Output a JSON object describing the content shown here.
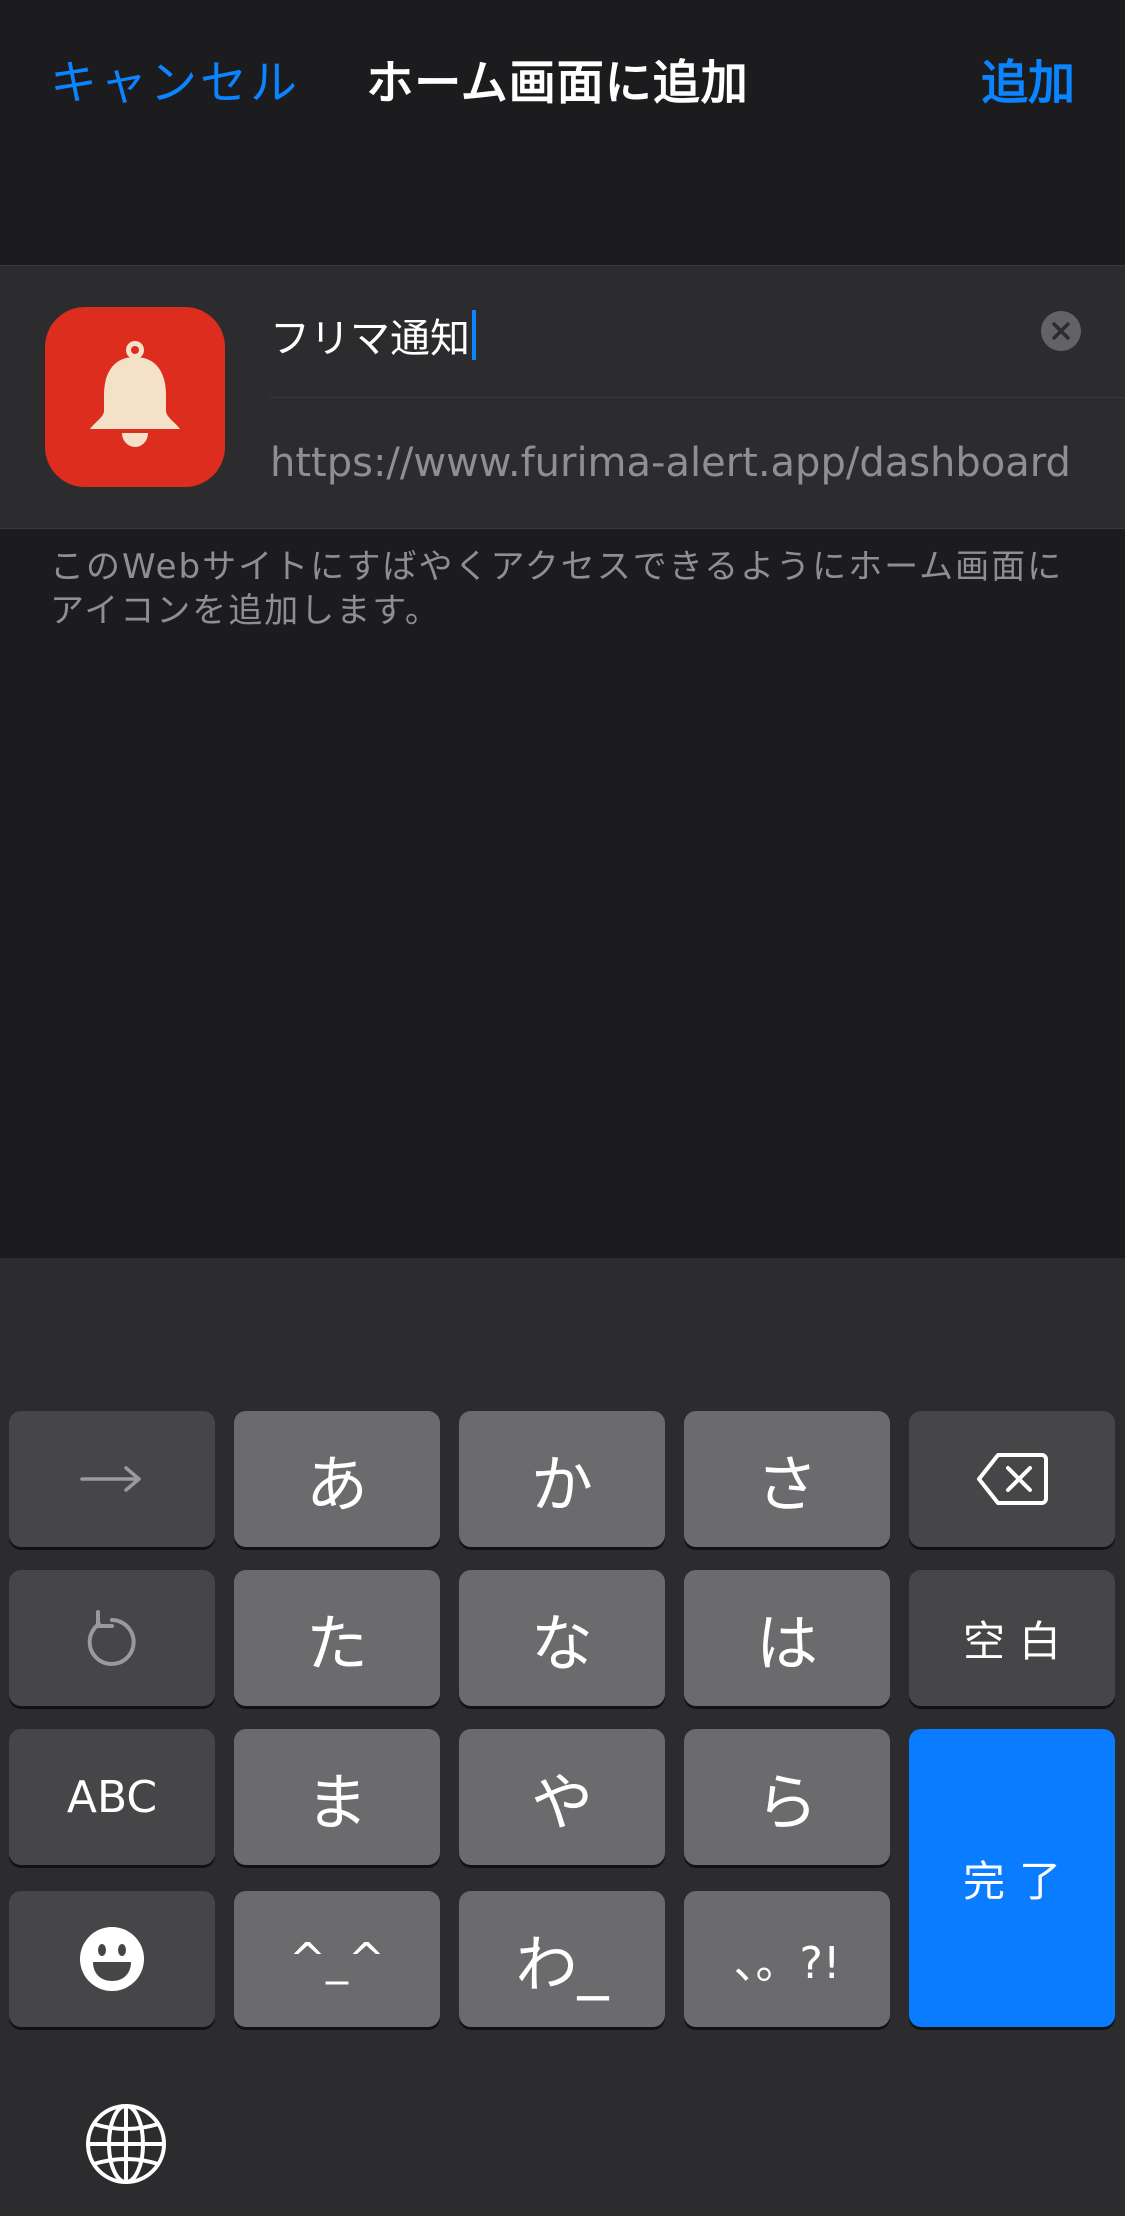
{
  "nav": {
    "cancel_label": "キャンセル",
    "title": "ホーム画面に追加",
    "add_label": "追加"
  },
  "form": {
    "app_icon_name": "bell-icon",
    "name_value": "フリマ通知",
    "url_value": "https://www.furima-alert.app/dashboard",
    "icon_bg_color": "#dc2d1e"
  },
  "note": {
    "text": "このWebサイトにすばやくアクセスできるようにホーム画面にアイコンを追加します。"
  },
  "keyboard": {
    "row1": [
      "→",
      "あ",
      "か",
      "さ",
      "backspace"
    ],
    "row2": [
      "undo",
      "た",
      "な",
      "は",
      "空白"
    ],
    "row3": [
      "ABC",
      "ま",
      "や",
      "ら"
    ],
    "row4": [
      "emoji",
      "^_^",
      "わ_",
      "、。?!"
    ],
    "space_label": "空白",
    "done_label": "完了",
    "abc_label": "ABC",
    "arrow_label": "→",
    "kaomoji_label": "^_^",
    "wa_label": "わ_",
    "punct_label": "、。?!",
    "keys": {
      "a": "あ",
      "ka": "か",
      "sa": "さ",
      "ta": "た",
      "na": "な",
      "ha": "は",
      "ma": "ま",
      "ya": "や",
      "ra": "ら"
    },
    "accent_color": "#0a7cff"
  }
}
